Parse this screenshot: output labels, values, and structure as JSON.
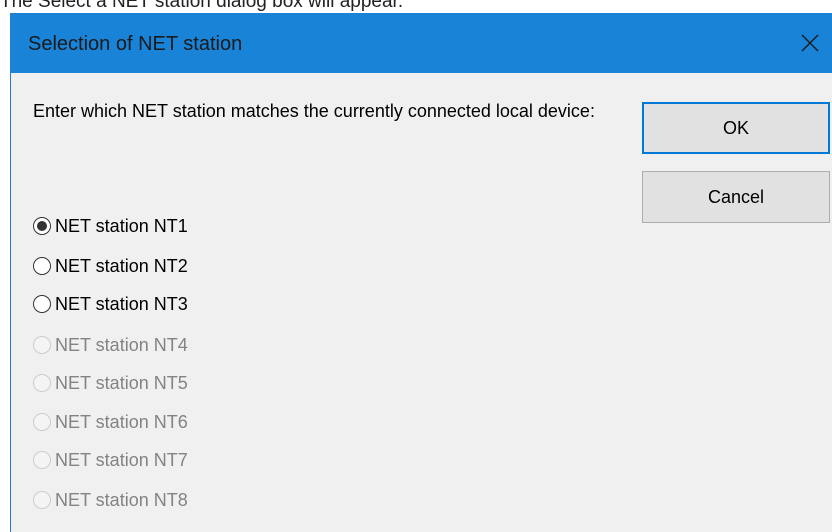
{
  "page_caption": "The Select a NET station dialog box will appear.",
  "dialog": {
    "title": "Selection of NET station",
    "prompt": "Enter which NET station matches the currently connected local device:",
    "ok_label": "OK",
    "cancel_label": "Cancel",
    "options": [
      {
        "label": "NET station NT1",
        "selected": true,
        "enabled": true
      },
      {
        "label": "NET station NT2",
        "selected": false,
        "enabled": true
      },
      {
        "label": "NET station NT3",
        "selected": false,
        "enabled": true
      },
      {
        "label": "NET station NT4",
        "selected": false,
        "enabled": false
      },
      {
        "label": "NET station NT5",
        "selected": false,
        "enabled": false
      },
      {
        "label": "NET station NT6",
        "selected": false,
        "enabled": false
      },
      {
        "label": "NET station NT7",
        "selected": false,
        "enabled": false
      },
      {
        "label": "NET station NT8",
        "selected": false,
        "enabled": false
      }
    ]
  },
  "colors": {
    "titlebar": "#1883d7",
    "dialog_background": "#f0f0f0",
    "default_button_border": "#0078d7",
    "disabled_text": "#838383"
  },
  "icons": {
    "close": "close-icon"
  }
}
